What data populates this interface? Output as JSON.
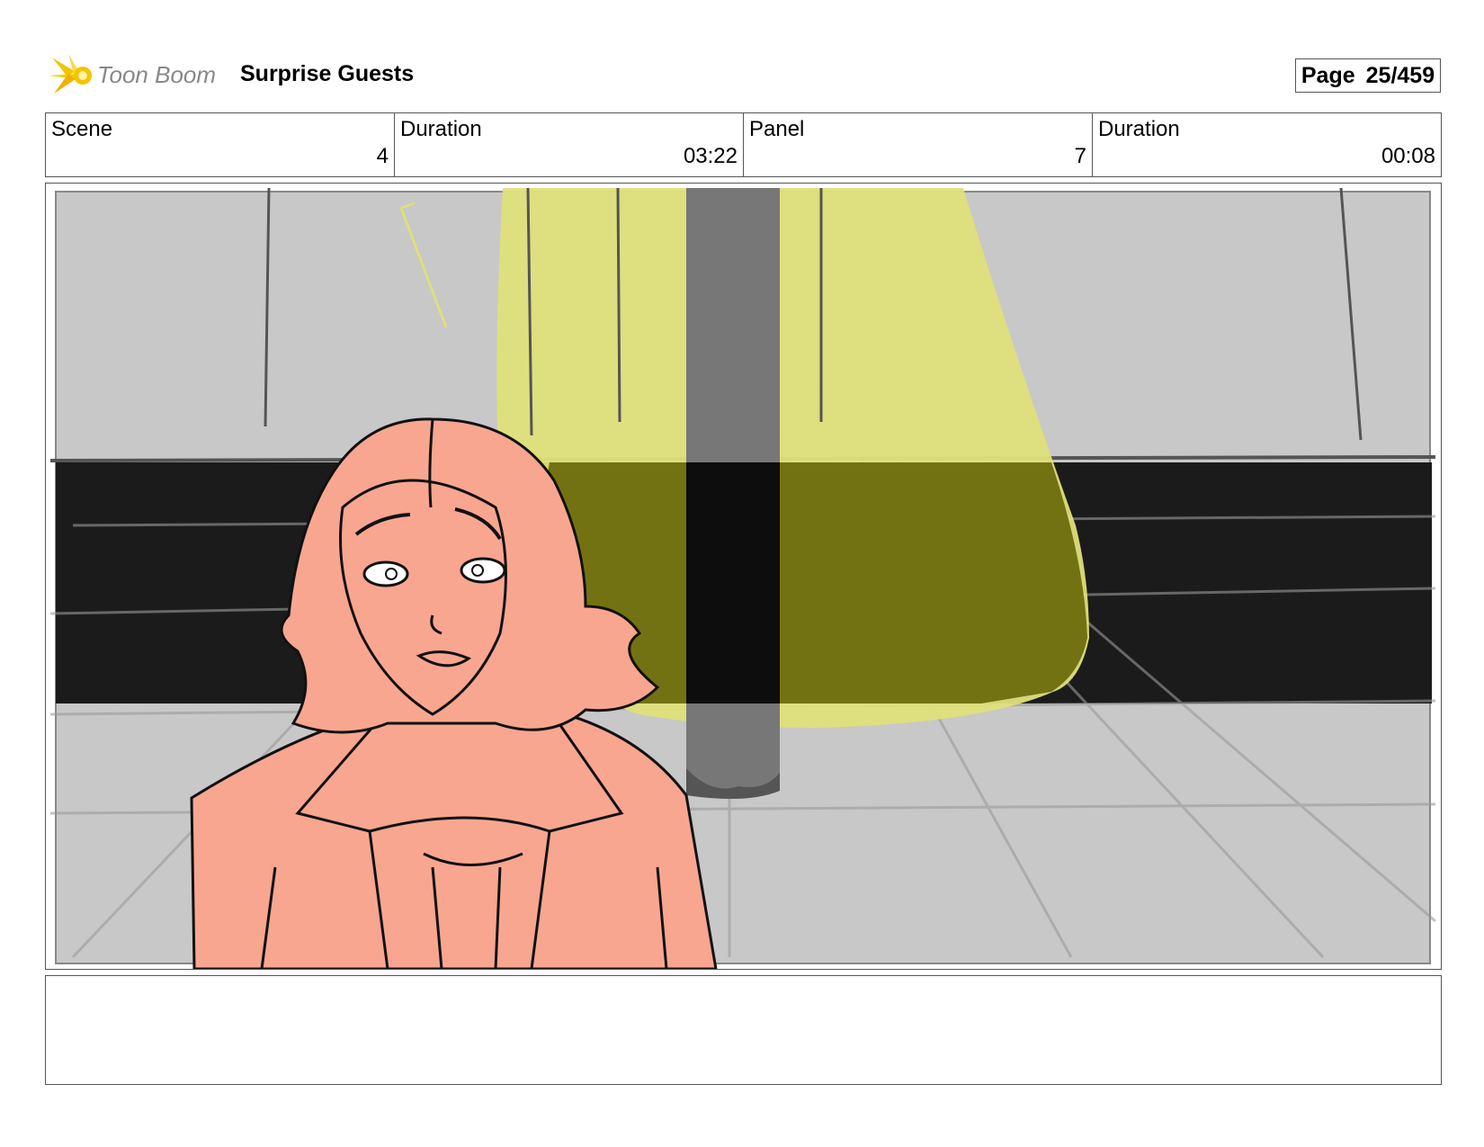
{
  "header": {
    "logo_text": "Toon Boom",
    "project_title": "Surprise Guests",
    "page_label": "Page",
    "page_number": "25/459"
  },
  "info": [
    {
      "label": "Scene",
      "value": "4"
    },
    {
      "label": "Duration",
      "value": "03:22"
    },
    {
      "label": "Panel",
      "value": "7"
    },
    {
      "label": "Duration",
      "value": "00:08"
    }
  ],
  "panel": {
    "description": "",
    "colors": {
      "background": "#c8c8c8",
      "spotlight": "#dfe07a",
      "band": "#1b1b1b",
      "pillar": "#777777",
      "character": "#f8a690"
    }
  },
  "notes": {
    "text": ""
  }
}
